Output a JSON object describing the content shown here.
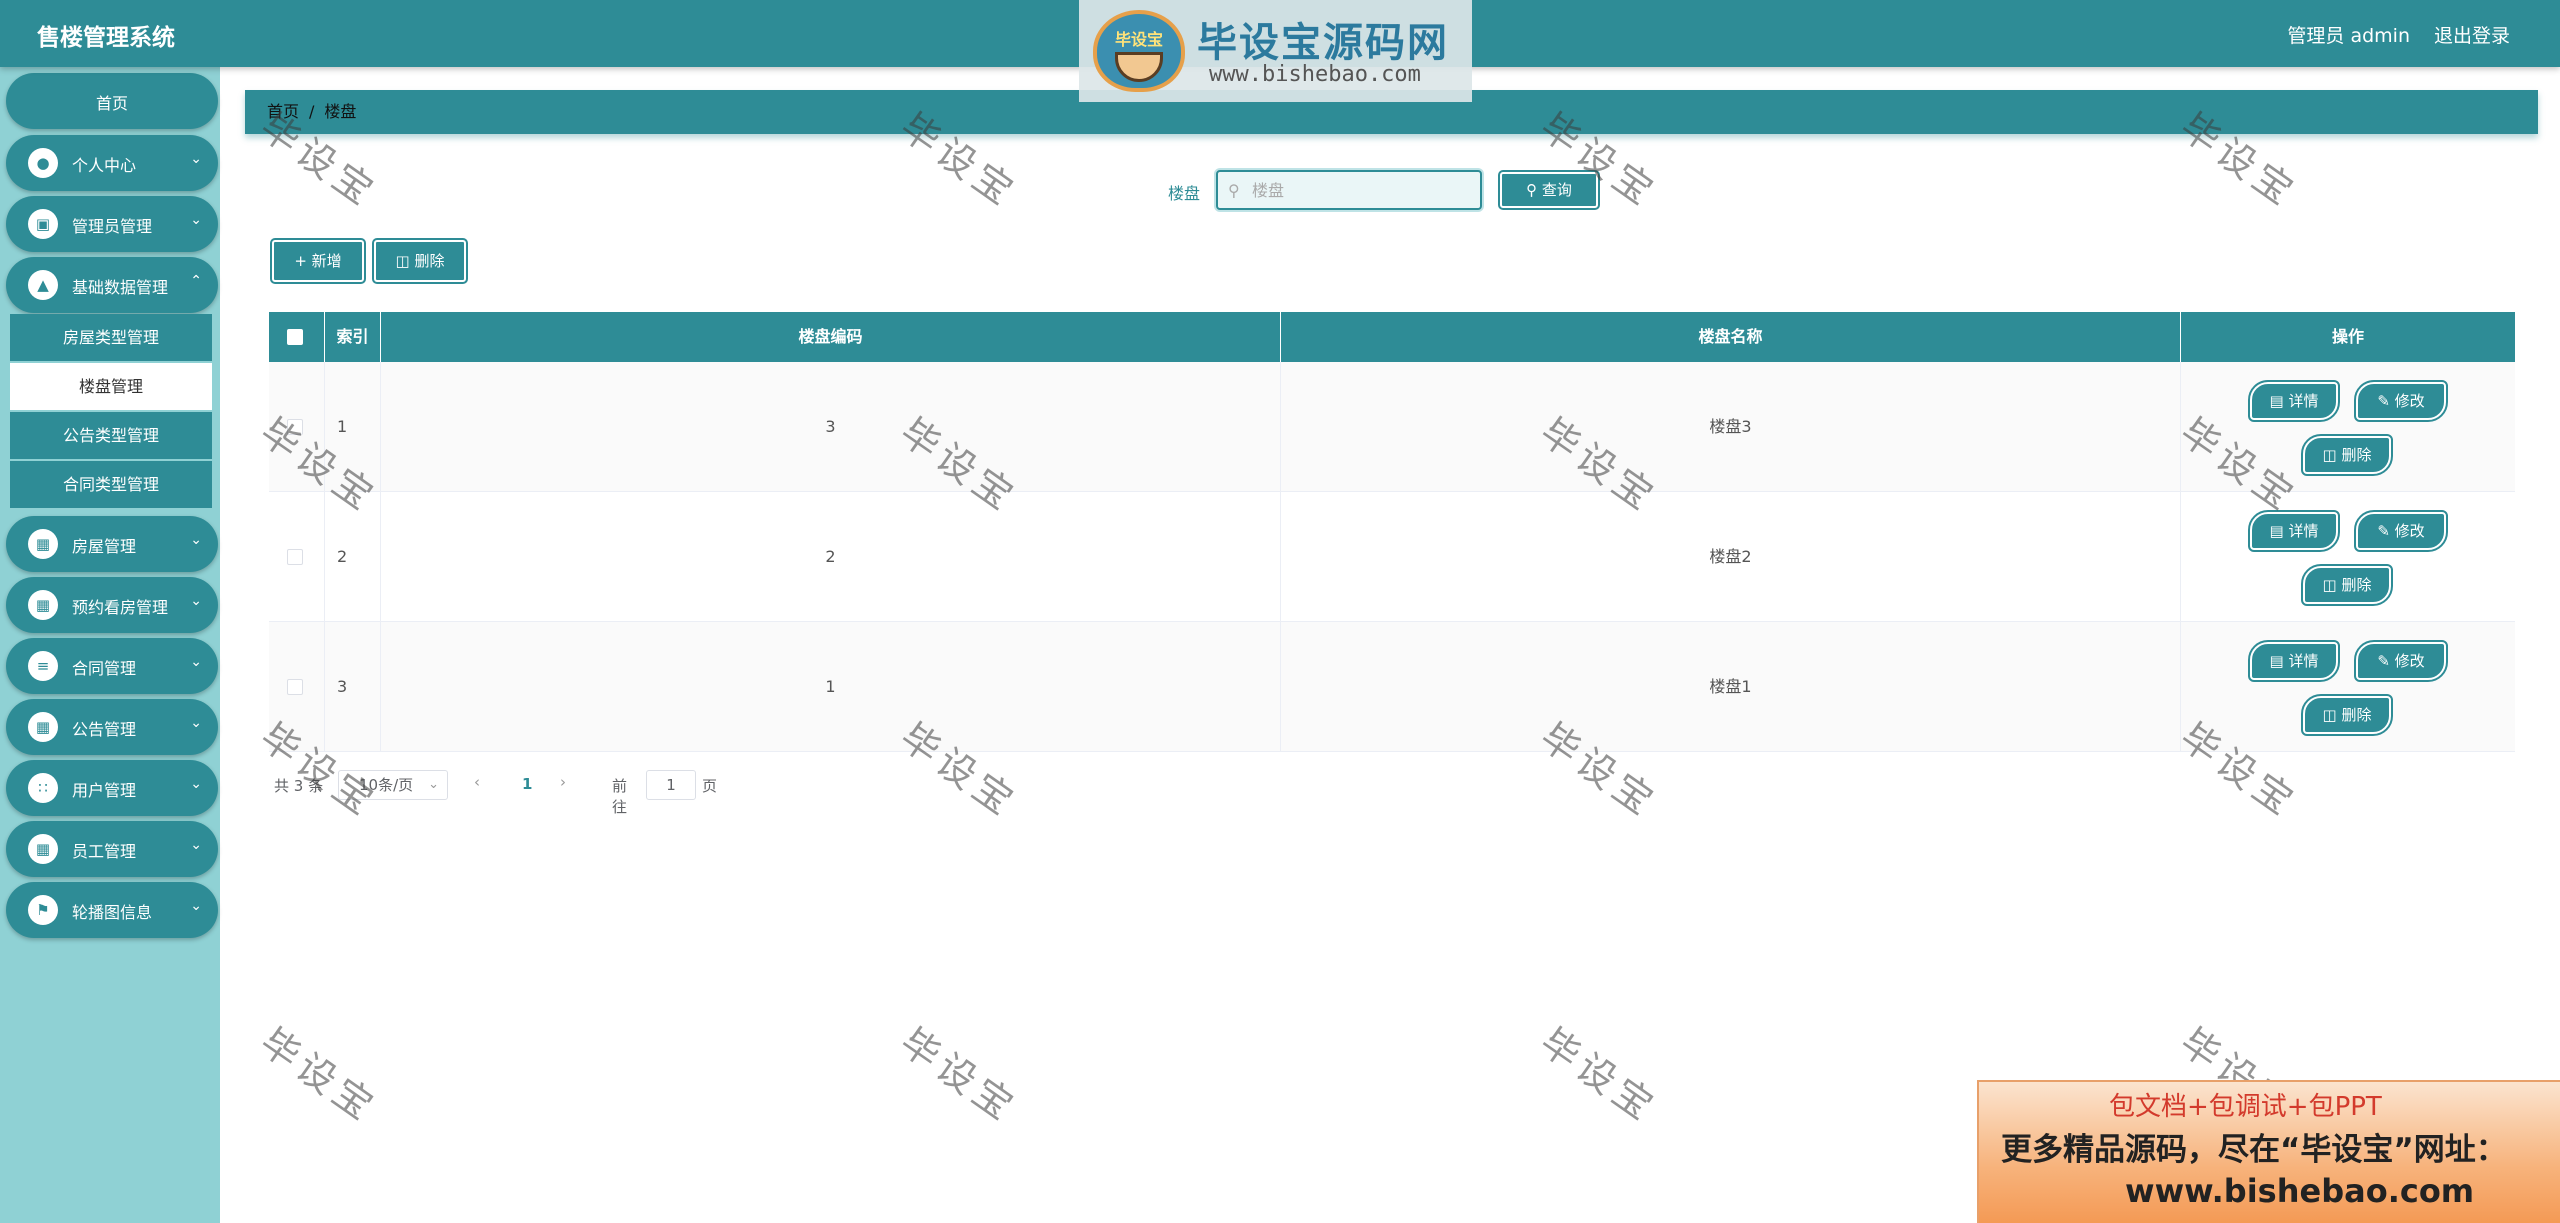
{
  "header": {
    "app_title": "售楼管理系统",
    "admin_label": "管理员 admin",
    "logout_label": "退出登录"
  },
  "logo": {
    "badge_text": "毕设宝",
    "brand_name": "毕设宝源码网",
    "url": "www.bishebao.com"
  },
  "sidebar": {
    "home": "首页",
    "menus": [
      {
        "label": "个人中心",
        "icon": "user-icon"
      },
      {
        "label": "管理员管理",
        "icon": "clipboard-icon"
      },
      {
        "label": "基础数据管理",
        "icon": "thumb-icon"
      }
    ],
    "submenus": [
      {
        "label": "房屋类型管理"
      },
      {
        "label": "楼盘管理"
      },
      {
        "label": "公告类型管理"
      },
      {
        "label": "合同类型管理"
      }
    ],
    "menus_after": [
      {
        "label": "房屋管理",
        "icon": "grid-icon"
      },
      {
        "label": "预约看房管理",
        "icon": "grid-icon"
      },
      {
        "label": "合同管理",
        "icon": "sliders-icon"
      },
      {
        "label": "公告管理",
        "icon": "grid-icon"
      },
      {
        "label": "用户管理",
        "icon": "apps-icon"
      },
      {
        "label": "员工管理",
        "icon": "grid-icon"
      },
      {
        "label": "轮播图信息",
        "icon": "flag-icon"
      }
    ]
  },
  "breadcrumb": {
    "home": "首页",
    "separator": "/",
    "current": "楼盘"
  },
  "search": {
    "label": "楼盘",
    "placeholder": "楼盘",
    "button": "查询"
  },
  "toolbar": {
    "add_label": "新增",
    "delete_label": "删除"
  },
  "table": {
    "columns": [
      "索引",
      "楼盘编码",
      "楼盘名称",
      "操作"
    ],
    "rows": [
      {
        "index": "1",
        "code": "3",
        "name": "楼盘3"
      },
      {
        "index": "2",
        "code": "2",
        "name": "楼盘2"
      },
      {
        "index": "3",
        "code": "1",
        "name": "楼盘1"
      }
    ],
    "actions": {
      "detail": "详情",
      "edit": "修改",
      "delete": "删除"
    }
  },
  "pagination": {
    "total": "共 3 条",
    "page_size": "10条/页",
    "current_page": "1",
    "goto_label": "前往",
    "goto_value": "1",
    "page_unit": "页"
  },
  "watermark": "毕设宝",
  "promo": {
    "line1": "包文档+包调试+包PPT",
    "line2": "更多精品源码，尽在“毕设宝”网址：",
    "line3": "www.bishebao.com"
  },
  "colors": {
    "accent": "#2e8c96",
    "sidebar_bg": "#8fd1d4",
    "active_page": "#2e8c96"
  }
}
